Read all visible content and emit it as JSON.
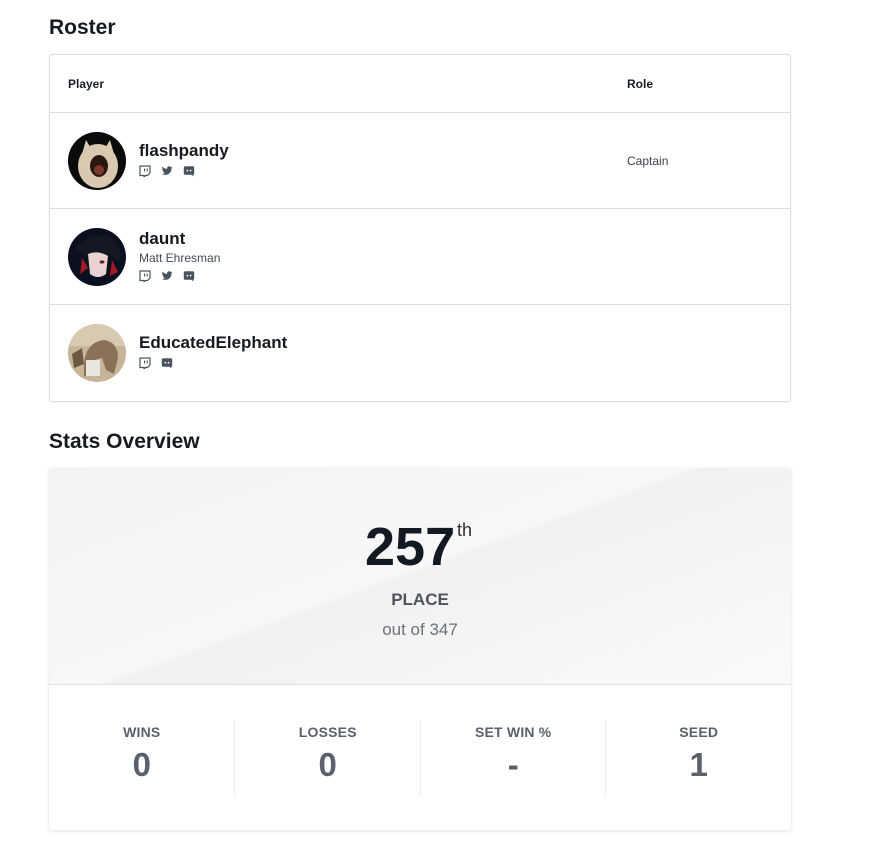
{
  "roster": {
    "title": "Roster",
    "columns": {
      "player": "Player",
      "role": "Role"
    },
    "players": [
      {
        "name": "flashpandy",
        "real_name": "",
        "role": "Captain",
        "socials": [
          "twitch-icon",
          "twitter-icon",
          "discord-icon"
        ]
      },
      {
        "name": "daunt",
        "real_name": "Matt Ehresman",
        "role": "",
        "socials": [
          "twitch-icon",
          "twitter-icon",
          "discord-icon"
        ]
      },
      {
        "name": "EducatedElephant",
        "real_name": "",
        "role": "",
        "socials": [
          "twitch-icon",
          "discord-icon"
        ]
      }
    ]
  },
  "stats": {
    "title": "Stats Overview",
    "place": "257",
    "place_suffix": "th",
    "place_label": "PLACE",
    "place_total": "out of 347",
    "items": [
      {
        "label": "WINS",
        "value": "0"
      },
      {
        "label": "LOSSES",
        "value": "0"
      },
      {
        "label": "SET WIN %",
        "value": "-"
      },
      {
        "label": "SEED",
        "value": "1"
      }
    ]
  }
}
